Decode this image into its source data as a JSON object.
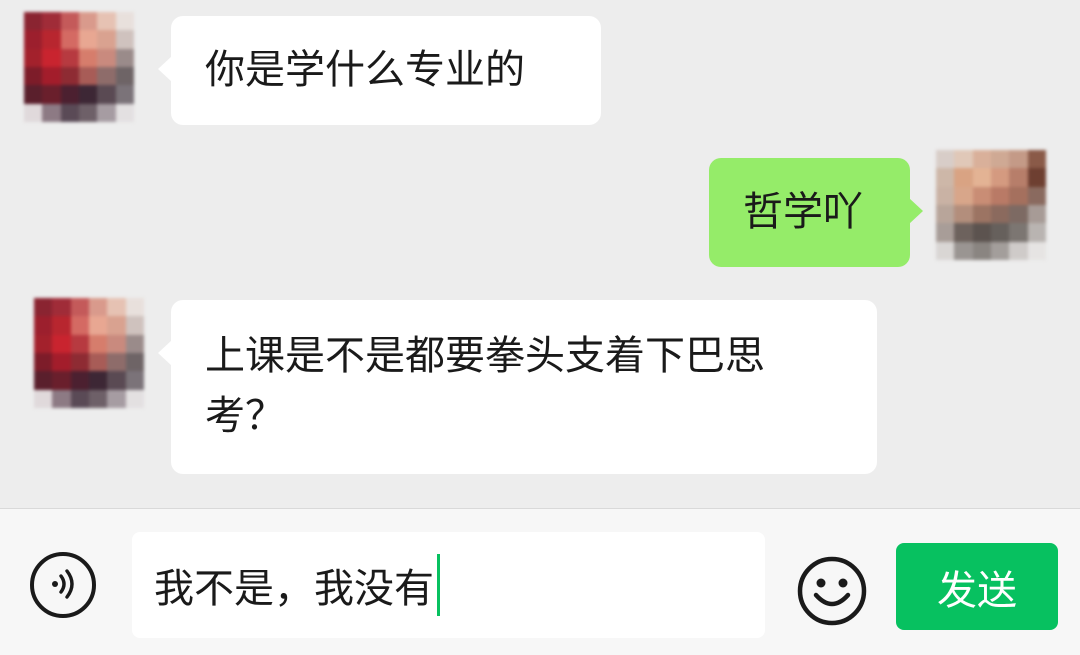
{
  "messages": [
    {
      "side": "left",
      "text": "你是学什么专业的"
    },
    {
      "side": "right",
      "text": "哲学吖"
    },
    {
      "side": "left",
      "text": "上课是不是都要拳头支着下巴思考？"
    }
  ],
  "input_bar": {
    "draft_text": "我不是，我没有",
    "send_label": "发送",
    "voice_icon": "voice-icon",
    "emoji_icon": "emoji-icon"
  },
  "colors": {
    "background": "#ededed",
    "incoming_bubble": "#ffffff",
    "outgoing_bubble": "#95ec69",
    "send_button": "#07c160",
    "caret": "#07c160"
  }
}
